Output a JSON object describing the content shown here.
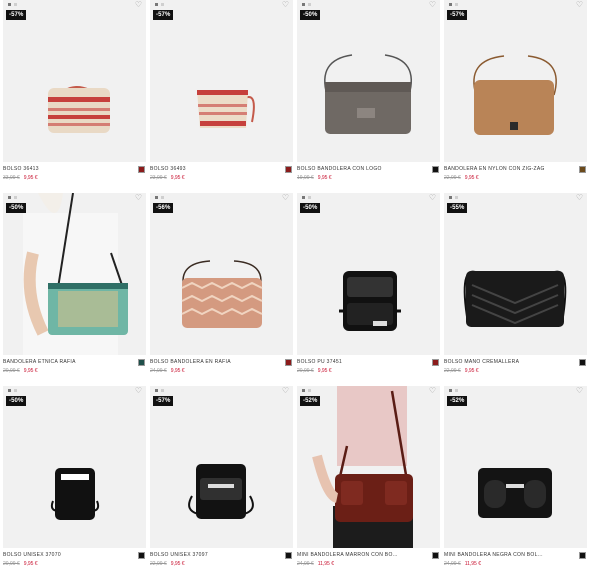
{
  "products": [
    {
      "name": "BOLSO 36413",
      "old_price": "33,99 €",
      "new_price": "9,95 €",
      "discount": "-57%",
      "swatch": "#8b1b1b"
    },
    {
      "name": "BOLSO 36493",
      "old_price": "23,99 €",
      "new_price": "9,95 €",
      "discount": "-57%",
      "swatch": "#8b1b1b"
    },
    {
      "name": "BOLSO BANDOLERA CON LOGO",
      "old_price": "19,99 €",
      "new_price": "9,95 €",
      "discount": "-50%",
      "swatch": "#111111"
    },
    {
      "name": "BANDOLERA EN NYLON CON ZIG-ZAG",
      "old_price": "22,99 €",
      "new_price": "9,95 €",
      "discount": "-57%",
      "swatch": "#6b4a1c"
    },
    {
      "name": "BANDOLERA ETNICA RAFIA",
      "old_price": "20,99 €",
      "new_price": "9,95 €",
      "discount": "-50%",
      "swatch": "#1f4f4a"
    },
    {
      "name": "BOLSO BANDOLERA EN RAFIA",
      "old_price": "24,99 €",
      "new_price": "9,95 €",
      "discount": "-56%",
      "swatch": "#8b1b1b"
    },
    {
      "name": "BOLSO PU 37451",
      "old_price": "20,99 €",
      "new_price": "9,95 €",
      "discount": "-50%",
      "swatch": "#8b1b1b"
    },
    {
      "name": "BOLSO MANO CREMALLERA",
      "old_price": "22,99 €",
      "new_price": "9,95 €",
      "discount": "-55%",
      "swatch": "#111111"
    },
    {
      "name": "BOLSO UNISEX 37070",
      "old_price": "20,99 €",
      "new_price": "9,95 €",
      "discount": "-50%",
      "swatch": "#111111"
    },
    {
      "name": "BOLSO UNISEX 37097",
      "old_price": "22,99 €",
      "new_price": "9,95 €",
      "discount": "-57%",
      "swatch": "#111111"
    },
    {
      "name": "MINI BANDOLERA MARRON CON BO...",
      "old_price": "24,99 €",
      "new_price": "11,95 €",
      "discount": "-52%",
      "swatch": "#111111"
    },
    {
      "name": "MINI BANDOLERA NEGRA CON BOL...",
      "old_price": "24,99 €",
      "new_price": "11,95 €",
      "discount": "-52%",
      "swatch": "#111111"
    }
  ],
  "icons": {
    "favorite": "heart-outline-icon"
  },
  "colors": {
    "discount_bg": "#111111",
    "sale_price": "#c8102e",
    "old_price": "#999999"
  }
}
